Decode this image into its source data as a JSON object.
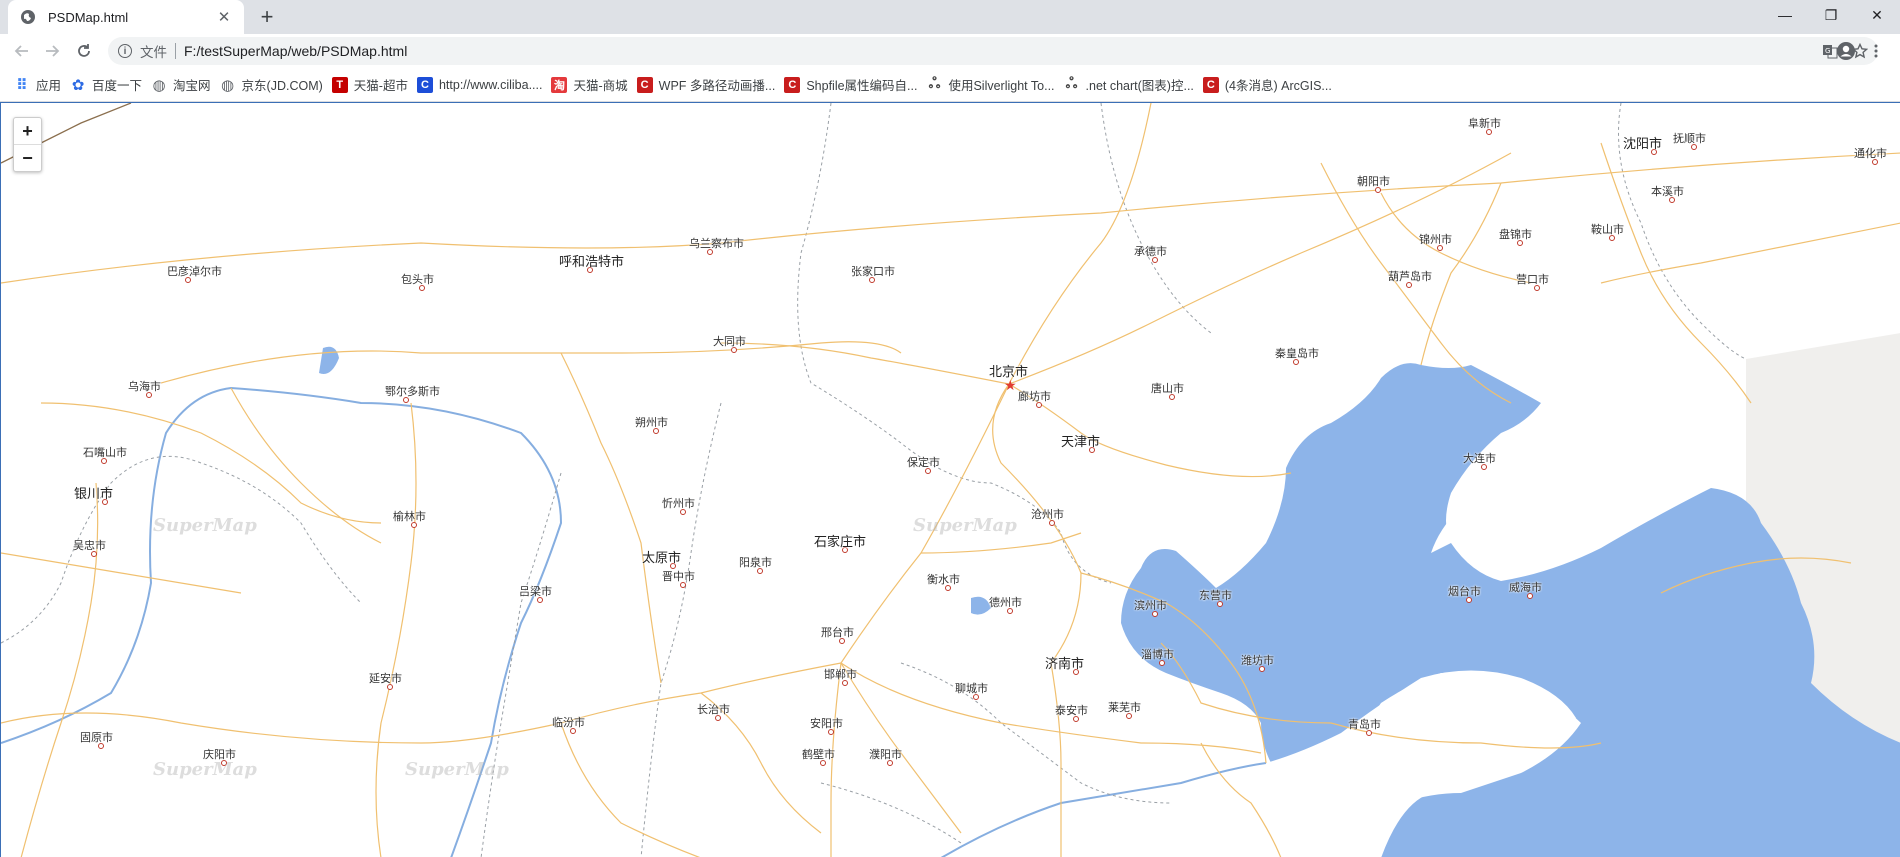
{
  "tab": {
    "title": "PSDMap.html",
    "close": "✕",
    "new_tab": "+"
  },
  "window": {
    "minimize": "—",
    "restore": "❐",
    "close": "✕"
  },
  "address": {
    "label": "文件",
    "url": "F:/testSuperMap/web/PSDMap.html"
  },
  "bookmarks": [
    {
      "label": "应用",
      "icon": "apps-icon",
      "color": "#4285f4"
    },
    {
      "label": "百度一下",
      "icon": "baidu-paw-icon",
      "color": "#2d6be4"
    },
    {
      "label": "淘宝网",
      "icon": "globe-icon",
      "color": "#5f6368"
    },
    {
      "label": "京东(JD.COM)",
      "icon": "globe-icon",
      "color": "#5f6368"
    },
    {
      "label": "天猫-超市",
      "icon": "tmall-icon",
      "color": "#c40000"
    },
    {
      "label": "http://www.ciliba....",
      "icon": "c-icon",
      "color": "#1d4ed8"
    },
    {
      "label": "天猫-商城",
      "icon": "tmall-shop-icon",
      "color": "#e4393c"
    },
    {
      "label": "WPF 多路径动画播...",
      "icon": "csdn-icon",
      "color": "#c81d1d"
    },
    {
      "label": "Shpfile属性编码自...",
      "icon": "csdn-icon",
      "color": "#c81d1d"
    },
    {
      "label": "使用Silverlight To...",
      "icon": "cnblogs-icon",
      "color": "#444444"
    },
    {
      "label": ".net chart(图表)控...",
      "icon": "cnblogs-icon",
      "color": "#444444"
    },
    {
      "label": "(4条消息) ArcGIS...",
      "icon": "csdn-icon",
      "color": "#c81d1d"
    }
  ],
  "zoom": {
    "in": "+",
    "out": "−"
  },
  "map": {
    "sea_color": "#8db4e9",
    "road_color": "#f0c070",
    "capital": "北京市",
    "watermark": "SuperMap",
    "cities": [
      {
        "name": "呼和浩特市",
        "big": true
      },
      {
        "name": "乌兰察布市",
        "big": false
      },
      {
        "name": "张家口市",
        "big": false
      },
      {
        "name": "承德市",
        "big": false
      },
      {
        "name": "阜新市",
        "big": false
      },
      {
        "name": "沈阳市",
        "big": true
      },
      {
        "name": "抚顺市",
        "big": false
      },
      {
        "name": "通化市",
        "big": false
      },
      {
        "name": "朝阳市",
        "big": false
      },
      {
        "name": "本溪市",
        "big": false
      },
      {
        "name": "锦州市",
        "big": false
      },
      {
        "name": "盘锦市",
        "big": false
      },
      {
        "name": "鞍山市",
        "big": false
      },
      {
        "name": "葫芦岛市",
        "big": false
      },
      {
        "name": "营口市",
        "big": false
      },
      {
        "name": "巴彦淖尔市",
        "big": false
      },
      {
        "name": "包头市",
        "big": false
      },
      {
        "name": "大同市",
        "big": false
      },
      {
        "name": "秦皇岛市",
        "big": false
      },
      {
        "name": "乌海市",
        "big": false
      },
      {
        "name": "鄂尔多斯市",
        "big": false
      },
      {
        "name": "廊坊市",
        "big": false
      },
      {
        "name": "唐山市",
        "big": false
      },
      {
        "name": "朔州市",
        "big": false
      },
      {
        "name": "天津市",
        "big": true
      },
      {
        "name": "石嘴山市",
        "big": false
      },
      {
        "name": "保定市",
        "big": false
      },
      {
        "name": "大连市",
        "big": false
      },
      {
        "name": "银川市",
        "big": true
      },
      {
        "name": "榆林市",
        "big": false
      },
      {
        "name": "忻州市",
        "big": false
      },
      {
        "name": "沧州市",
        "big": false
      },
      {
        "name": "吴忠市",
        "big": false
      },
      {
        "name": "石家庄市",
        "big": true
      },
      {
        "name": "太原市",
        "big": true
      },
      {
        "name": "阳泉市",
        "big": false
      },
      {
        "name": "晋中市",
        "big": false
      },
      {
        "name": "衡水市",
        "big": false
      },
      {
        "name": "吕梁市",
        "big": false
      },
      {
        "name": "德州市",
        "big": false
      },
      {
        "name": "滨州市",
        "big": false
      },
      {
        "name": "东营市",
        "big": false
      },
      {
        "name": "烟台市",
        "big": false
      },
      {
        "name": "威海市",
        "big": false
      },
      {
        "name": "邢台市",
        "big": false
      },
      {
        "name": "淄博市",
        "big": false
      },
      {
        "name": "济南市",
        "big": true
      },
      {
        "name": "潍坊市",
        "big": false
      },
      {
        "name": "邯郸市",
        "big": false
      },
      {
        "name": "延安市",
        "big": false
      },
      {
        "name": "聊城市",
        "big": false
      },
      {
        "name": "长治市",
        "big": false
      },
      {
        "name": "泰安市",
        "big": false
      },
      {
        "name": "莱芜市",
        "big": false
      },
      {
        "name": "临汾市",
        "big": false
      },
      {
        "name": "安阳市",
        "big": false
      },
      {
        "name": "青岛市",
        "big": false
      },
      {
        "name": "固原市",
        "big": false
      },
      {
        "name": "庆阳市",
        "big": false
      },
      {
        "name": "鹤壁市",
        "big": false
      },
      {
        "name": "濮阳市",
        "big": false
      }
    ]
  }
}
